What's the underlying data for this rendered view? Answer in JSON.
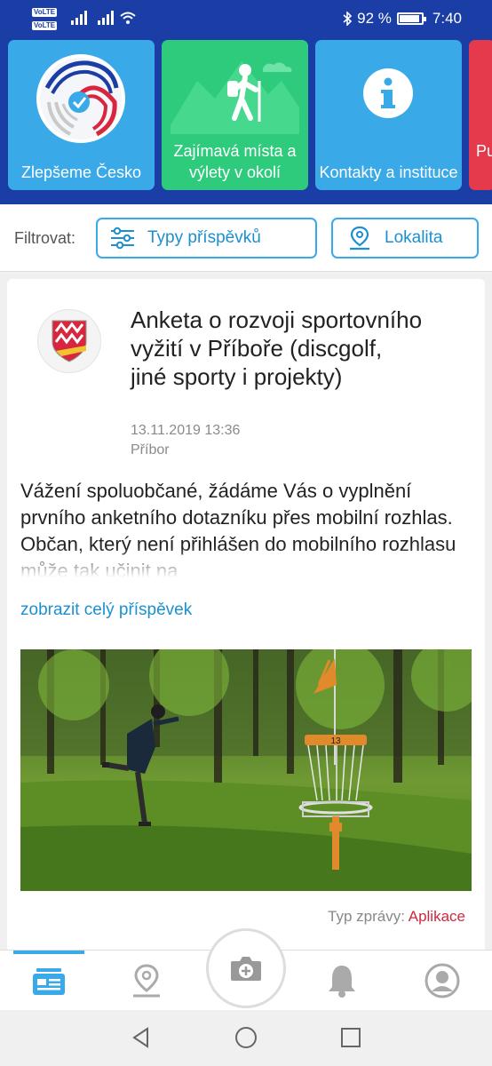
{
  "status_bar": {
    "volte_1": "VoLTE",
    "volte_2": "VoLTE",
    "battery_percent": "92 %",
    "battery_level": 0.92,
    "time": "7:40",
    "icons": [
      "signal-icon",
      "signal-icon",
      "wifi-icon",
      "bluetooth-icon",
      "battery-icon"
    ]
  },
  "tiles": [
    {
      "label": "Zlepšeme Česko",
      "icon": "fingerprint-check-icon",
      "color": "#3aa9e8"
    },
    {
      "label": "Zajímavá místa a výlety v okolí",
      "icon": "hiker-icon",
      "color": "#2fcb7d"
    },
    {
      "label": "Kontakty a instituce",
      "icon": "info-icon",
      "color": "#3aa9e8"
    },
    {
      "label": "Pu",
      "icon": "",
      "color": "#e53a4c"
    }
  ],
  "filter": {
    "label": "Filtrovat:",
    "types_button": "Typy příspěvků",
    "location_button": "Lokalita",
    "accent": "#1c8fd0"
  },
  "post": {
    "crest_icon": "town-crest-icon",
    "title": "Anketa o rozvoji sportovního vyžití v Příboře (discgolf, jiné sporty i projekty)",
    "date": "13.11.2019 13:36",
    "place": "Příbor",
    "body": "Vážení spoluobčané, žádáme Vás o  vyplnění prvního anketního dotazníku přes mobilní rozhlas. Občan, který není přihlášen do mobilního rozhlasu může tak učinit na",
    "more_link": "zobrazit celý příspěvek",
    "photo_number": "13",
    "type_label": "Typ zprávy:",
    "type_value": "Aplikace"
  },
  "bottom_nav": {
    "items": [
      "news-icon",
      "location-pin-icon",
      "camera-plus-icon",
      "bell-icon",
      "user-icon"
    ],
    "active_index": 0
  },
  "system_nav": [
    "back-icon",
    "home-icon",
    "recents-icon"
  ]
}
